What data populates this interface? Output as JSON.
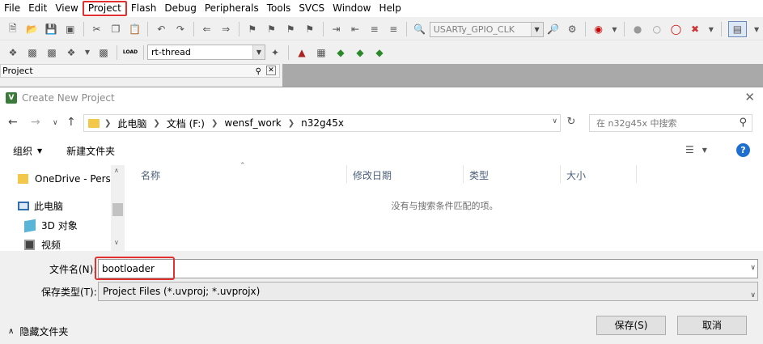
{
  "menubar": {
    "items": [
      "File",
      "Edit",
      "View",
      "Project",
      "Flash",
      "Debug",
      "Peripherals",
      "Tools",
      "SVCS",
      "Window",
      "Help"
    ],
    "active_index": 3
  },
  "toolbar1": {
    "target_combo": "USARTy_GPIO_CLK"
  },
  "toolbar2": {
    "target_combo": "rt-thread",
    "load_label": "LOAD"
  },
  "project_panel": {
    "title": "Project",
    "pin_icon": "pin-icon",
    "close_icon": "close-icon"
  },
  "dialog": {
    "title": "Create New Project",
    "logo": "V",
    "breadcrumbs": [
      "此电脑",
      "文档 (F:)",
      "wensf_work",
      "n32g45x"
    ],
    "search_placeholder": "在 n32g45x 中搜索",
    "organize_label": "组织",
    "new_folder_label": "新建文件夹",
    "help_label": "?",
    "nav_items": [
      "OneDrive - Perso",
      "此电脑",
      "3D 对象",
      "视频"
    ],
    "columns": [
      "名称",
      "修改日期",
      "类型",
      "大小"
    ],
    "empty_message": "没有与搜索条件匹配的项。",
    "filename_label": "文件名(N):",
    "filename_value": "bootloader",
    "filetype_label": "保存类型(T):",
    "filetype_value": "Project Files (*.uvproj; *.uvprojx)",
    "hide_folders_label": "隐藏文件夹",
    "save_button": "保存(S)",
    "cancel_button": "取消"
  },
  "colors": {
    "highlight": "#e03030",
    "accent": "#1f6fd0",
    "folder": "#f3c74a"
  }
}
